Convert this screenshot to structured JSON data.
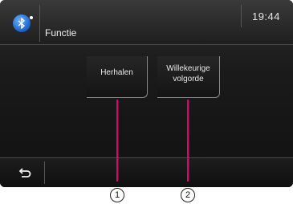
{
  "header": {
    "title": "Functie",
    "clock": "19:44",
    "bluetooth_icon": "bluetooth-icon"
  },
  "buttons": {
    "repeat_label": "Herhalen",
    "shuffle_label_line1": "Willekeurige",
    "shuffle_label_line2": "volgorde"
  },
  "footer": {
    "back_icon": "back-arrow-icon"
  },
  "callouts": {
    "one": "1",
    "two": "2"
  },
  "colors": {
    "callout_line": "#e2007a",
    "bluetooth": "#1660c8"
  }
}
